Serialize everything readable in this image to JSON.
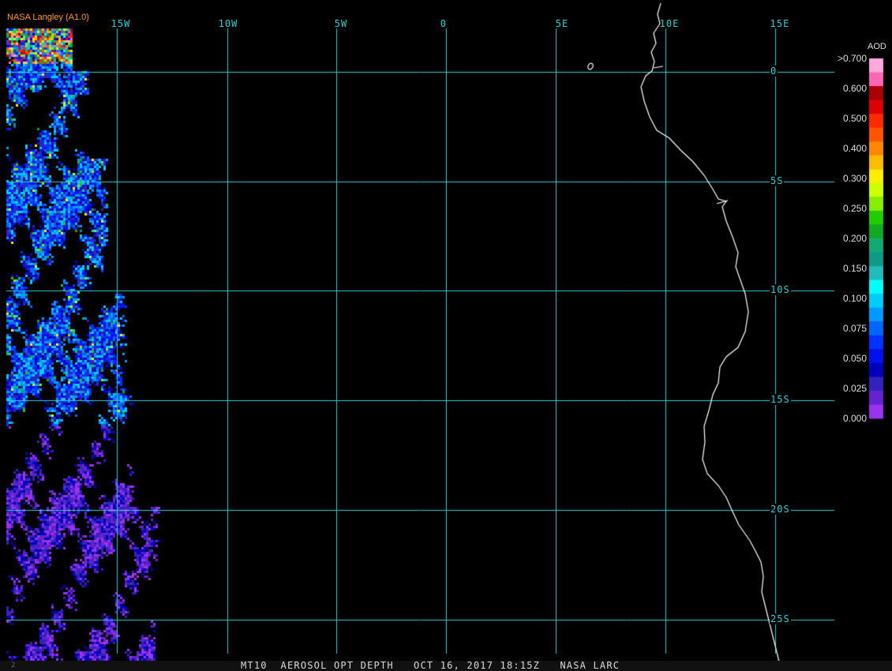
{
  "credit": "NASA Langley (A1.0)",
  "footer": "MT10  AEROSOL OPT DEPTH   OCT 16, 2017 18:15Z   NASA LARC",
  "footer_number": "2",
  "legend": {
    "title": "AOD",
    "labels": [
      ">0.700",
      "0.600",
      "0.500",
      "0.400",
      "0.300",
      "0.250",
      "0.200",
      "0.150",
      "0.100",
      "0.075",
      "0.050",
      "0.025",
      "0.000"
    ],
    "colors": [
      "#ffaadd",
      "#ff66b3",
      "#aa0000",
      "#dd0000",
      "#ff2a00",
      "#ff5500",
      "#ff8800",
      "#ffbb00",
      "#ffee00",
      "#ccff00",
      "#88ee00",
      "#22cc00",
      "#11aa22",
      "#11aa77",
      "#119988",
      "#22bbbb",
      "#00ffff",
      "#00ccff",
      "#0099ff",
      "#0066ff",
      "#0033ff",
      "#0011ee",
      "#0000bb",
      "#3322bb",
      "#6622cc",
      "#9933ee"
    ]
  },
  "lon_labels": [
    "15W",
    "10W",
    "5W",
    "0",
    "5E",
    "10E",
    "15E"
  ],
  "lat_labels": [
    "0",
    "5S",
    "10S",
    "15S",
    "20S",
    "25S"
  ],
  "colors": {
    "grid": "#2fd0d0",
    "coast": "#ffffff",
    "credit": "#ff9a2e"
  }
}
